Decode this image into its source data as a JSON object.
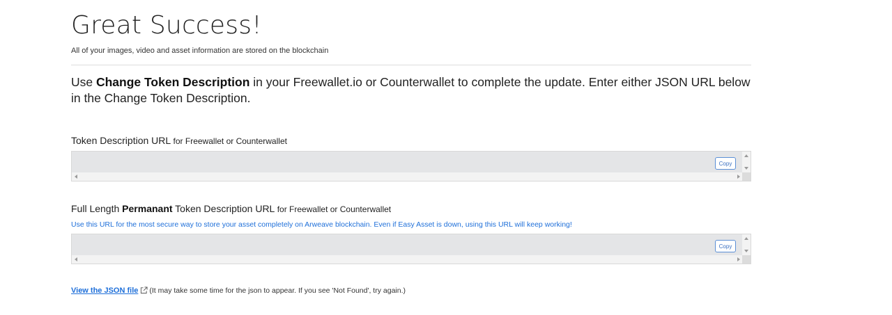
{
  "header": {
    "title": "Great Success!",
    "subtitle": "All of your images, video and asset information are stored on the blockchain"
  },
  "instructions": {
    "pre": "Use ",
    "bold": "Change Token Description",
    "post": " in your Freewallet.io or Counterwallet to complete the update. Enter either JSON URL below in the Change Token Description."
  },
  "field1": {
    "label": "Token Description URL",
    "label_suffix": "for Freewallet or Counterwallet",
    "value": "",
    "copy_label": "Copy"
  },
  "field2": {
    "label_pre": "Full Length ",
    "label_bold": "Permanant",
    "label_post": " Token Description URL",
    "label_suffix": "for Freewallet or Counterwallet",
    "hint": "Use this URL for the most secure way to store your asset completely on Arweave blockchain. Even if Easy Asset is down, using this URL will keep working!",
    "value": "",
    "copy_label": "Copy"
  },
  "json": {
    "link_label": "View the JSON file",
    "note": "(It may take some time for the json to appear. If you see 'Not Found', try again.)",
    "icon": "external-link-icon"
  },
  "colors": {
    "link": "#1e6fd9",
    "field_bg": "#e4e5e7"
  }
}
